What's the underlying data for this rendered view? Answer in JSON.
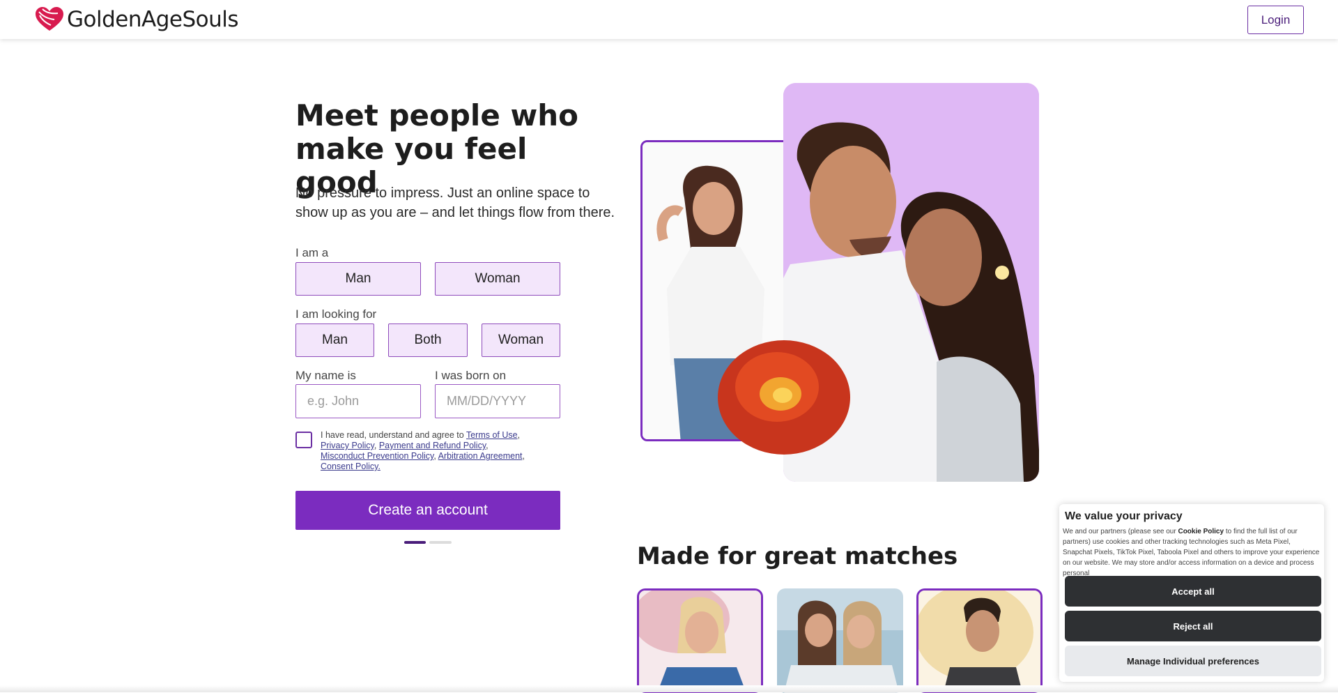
{
  "header": {
    "brand": "GoldenAgeSouls",
    "login_label": "Login"
  },
  "hero": {
    "title": "Meet people who make you feel good",
    "subtitle": "No pressure to impress. Just an online space to show up as you are – and let things flow from there."
  },
  "form": {
    "gender_label": "I am a",
    "gender_options": [
      "Man",
      "Woman"
    ],
    "seeking_label": "I am looking for",
    "seeking_options": [
      "Man",
      "Both",
      "Woman"
    ],
    "name_label": "My name is",
    "name_placeholder": "e.g. John",
    "dob_label": "I was born on",
    "dob_placeholder": "MM/DD/YYYY",
    "terms_prefix": "I have read, understand and agree to",
    "terms_links": {
      "terms_of_use": "Terms of Use",
      "privacy": "Privacy Policy",
      "payment": "Payment and Refund Policy",
      "misconduct": "Misconduct Prevention Policy",
      "arbitration": "Arbitration Agreement",
      "consent": "Consent Policy."
    },
    "submit_label": "Create an account"
  },
  "matches": {
    "title": "Made for great matches"
  },
  "cookie_banner": {
    "title": "We value your privacy",
    "text_before": "We and our partners (please see our",
    "policy_link": "Cookie Policy",
    "text_after": "to find the full list of our partners) use cookies and other tracking technologies such as Meta Pixel, Snapchat Pixels, TikTok Pixel, Taboola Pixel and others to improve your experience on our website. We may store and/or access information on a device and process personal",
    "accept_label": "Accept all",
    "reject_label": "Reject all",
    "manage_label": "Manage Individual preferences"
  },
  "colors": {
    "accent": "#7b2cbf",
    "option_bg": "#f3e6fb",
    "hero_bg": "#dfb8f5",
    "cookie_button": "#2e3033"
  }
}
